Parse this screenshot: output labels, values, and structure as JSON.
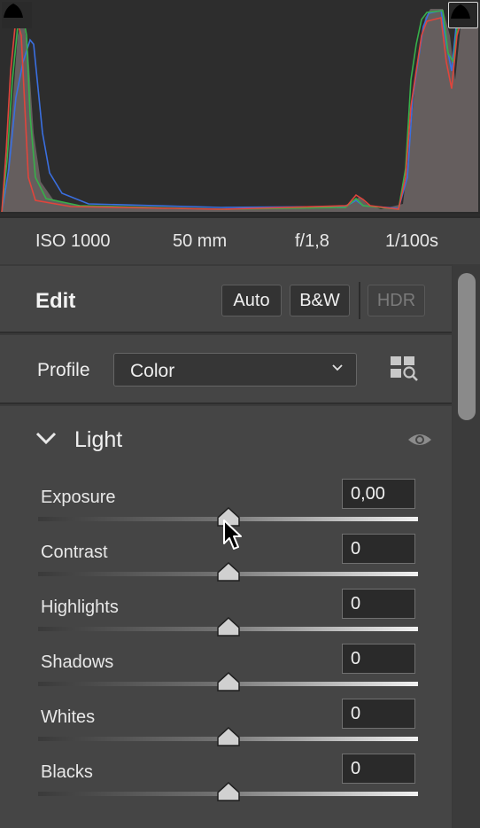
{
  "histogram": {
    "shadow_clip_icon": "shadow-clipping-warning-icon",
    "highlight_clip_icon": "highlight-clipping-warning-icon",
    "colors": {
      "red": "#e0453c",
      "green": "#37b04a",
      "blue": "#3a6fe0",
      "fill": "#6e6e6e"
    }
  },
  "meta": {
    "iso": "ISO 1000",
    "focal_length": "50 mm",
    "aperture": "f/1,8",
    "shutter": "1/100s"
  },
  "edit": {
    "title": "Edit",
    "auto_label": "Auto",
    "bw_label": "B&W",
    "hdr_label": "HDR"
  },
  "profile": {
    "label": "Profile",
    "value": "Color",
    "browse_icon": "profile-browser-icon"
  },
  "light": {
    "title": "Light",
    "sliders": [
      {
        "label": "Exposure",
        "value": "0,00",
        "position": 0.5
      },
      {
        "label": "Contrast",
        "value": "0",
        "position": 0.5
      },
      {
        "label": "Highlights",
        "value": "0",
        "position": 0.5
      },
      {
        "label": "Shadows",
        "value": "0",
        "position": 0.5
      },
      {
        "label": "Whites",
        "value": "0",
        "position": 0.5
      },
      {
        "label": "Blacks",
        "value": "0",
        "position": 0.5
      }
    ]
  }
}
